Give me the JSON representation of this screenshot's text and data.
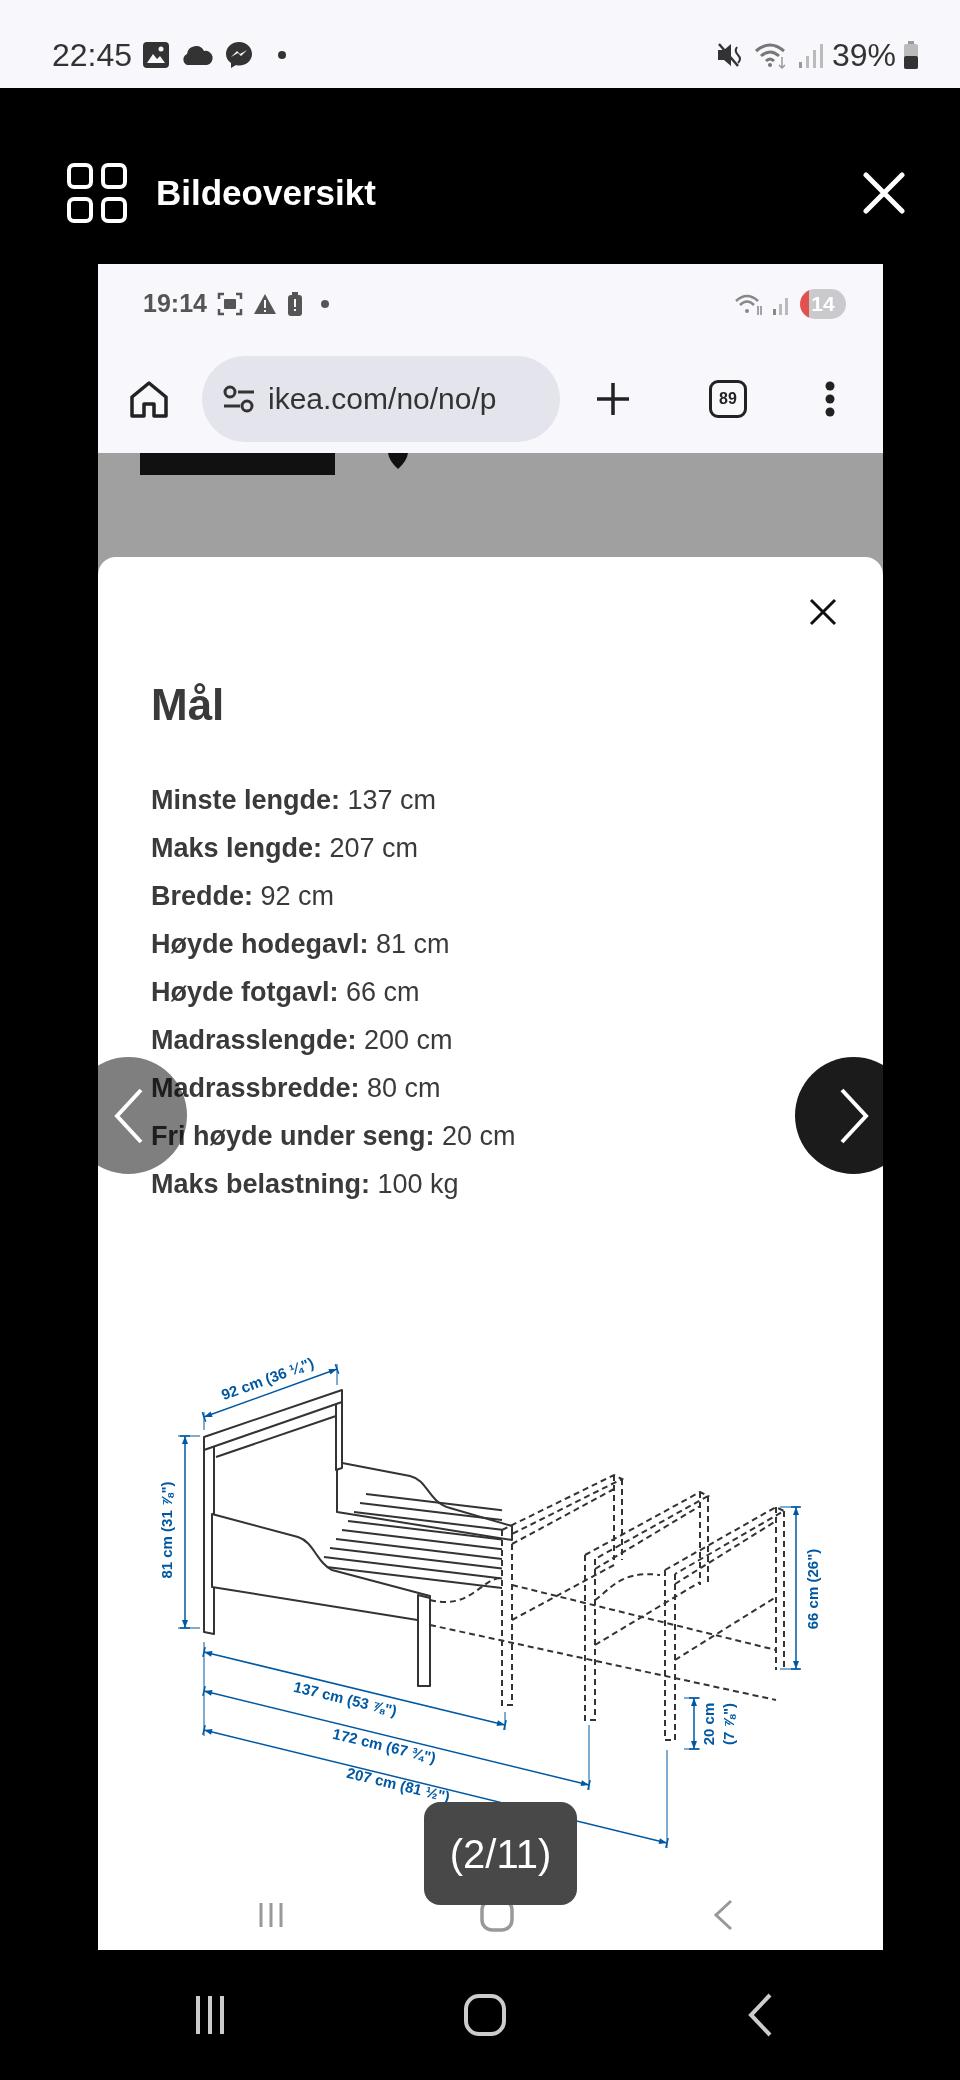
{
  "status_bar": {
    "time": "22:45",
    "battery": "39%"
  },
  "viewer": {
    "title": "Bildeoversikt",
    "counter": "(2/11)"
  },
  "screenshot": {
    "status_bar": {
      "time": "19:14",
      "battery": "14"
    },
    "browser": {
      "url": "ikea.com/no/no/p",
      "tab_count": "89"
    },
    "dialog": {
      "title": "Mål",
      "specs": [
        "**Minste lengde:** 137 cm",
        "**Maks lengde:** 207 cm",
        "**Bredde:** 92 cm",
        "**Høyde hodegavl:** 81 cm",
        "**Høyde fotgavl:** 66 cm",
        "**Madrasslengde:** 200 cm",
        "**Madrassbredde:** 80 cm",
        "**Fri høyde under seng:** 20 cm",
        "**Maks belastning:** 100 kg"
      ],
      "diagram": {
        "dimension_labels": [
          "92 cm (36 ¼\")",
          "81 cm (31 ⅞\")",
          "137 cm (53 ⅞\")",
          "172 cm (67 ¾\")",
          "207 cm (81 ½\")",
          "66 cm (26\")",
          "20 cm",
          "(7 ⅞\")"
        ]
      }
    }
  }
}
